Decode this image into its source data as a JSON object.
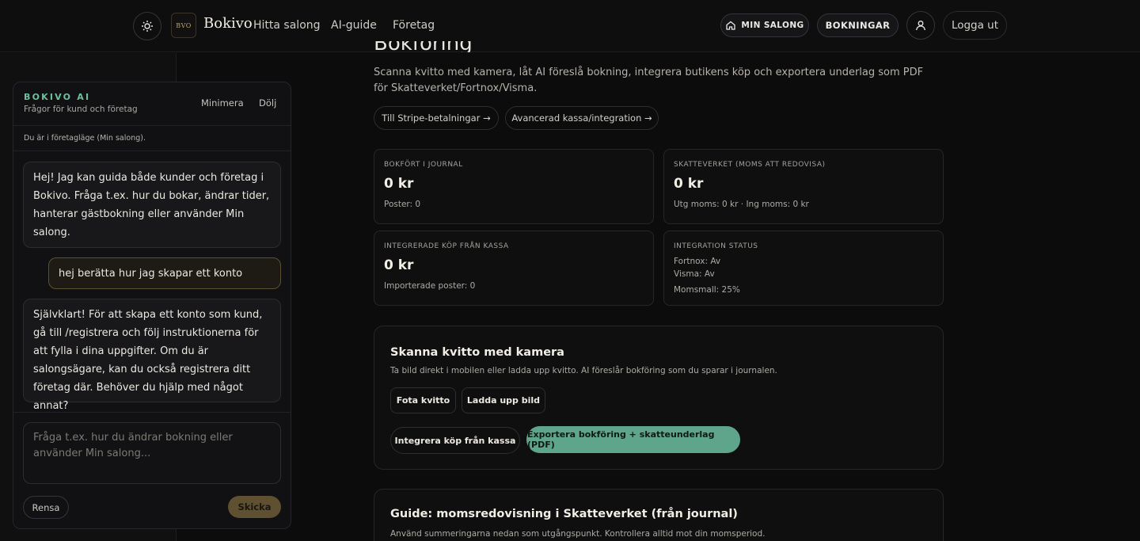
{
  "header": {
    "logo_text": "BVO",
    "brand": "Bokivo",
    "nav": [
      "Hitta salong",
      "AI-guide",
      "Företag"
    ],
    "my_salon": "MIN SALONG",
    "bookings": "BOKNINGAR",
    "logout": "Logga ut",
    "icons": [
      "sun-icon",
      "home-icon",
      "user-icon"
    ]
  },
  "chat": {
    "title": "BOKIVO AI",
    "subtitle": "Frågor för kund och företag",
    "minimize": "Minimera",
    "hide": "Dölj",
    "mode_notice": "Du är i företagläge (Min salong).",
    "messages": [
      {
        "role": "bot",
        "text": "Hej! Jag kan guida både kunder och företag i Bokivo. Fråga t.ex. hur du bokar, ändrar tider, hanterar gästbokning eller använder Min salong."
      },
      {
        "role": "user",
        "text": "hej berätta hur jag skapar ett konto"
      },
      {
        "role": "bot",
        "text": "Självklart! För att skapa ett konto som kund, gå till /registrera och följ instruktionerna för att fylla i dina uppgifter. Om du är salongsägare, kan du också registrera ditt företag där. Behöver du hjälp med något annat?"
      }
    ],
    "input_placeholder": "Fråga t.ex. hur du ändrar bokning eller använder Min salong...",
    "clear": "Rensa",
    "send": "Skicka"
  },
  "main": {
    "title_fragment": "Bokföring",
    "intro": "Scanna kvitto med kamera, låt AI föreslå bokning, integrera butikens köp och exportera underlag som PDF för Skatteverket/Fortnox/Visma.",
    "links": [
      "Till Stripe-betalningar →",
      "Avancerad kassa/integration →"
    ],
    "stats": [
      {
        "label": "BOKFÖRT I JOURNAL",
        "value": "0 kr",
        "note": "Poster: 0"
      },
      {
        "label": "SKATTEVERKET (MOMS ATT REDOVISA)",
        "value": "0 kr",
        "note": "Utg moms: 0 kr · Ing moms: 0 kr"
      },
      {
        "label": "INTEGRERADE KÖP FRÅN KASSA",
        "value": "0 kr",
        "note": "Importerade poster: 0"
      }
    ],
    "integration": {
      "label": "INTEGRATION STATUS",
      "lines": [
        "Fortnox: Av",
        "Visma: Av",
        "Momsmall: 25%"
      ]
    },
    "scan_panel": {
      "title": "Skanna kvitto med kamera",
      "desc": "Ta bild direkt i mobilen eller ladda upp kvitto. AI föreslår bokföring som du sparar i journalen.",
      "photo": "Fota kvitto",
      "upload": "Ladda upp bild",
      "integrate": "Integrera köp från kassa",
      "export": "Exportera bokföring + skatteunderlag (PDF)"
    },
    "guide_panel": {
      "title": "Guide: momsredovisning i Skatteverket (från journal)",
      "desc": "Använd summeringarna nedan som utgångspunkt. Kontrollera alltid mot din momsperiod."
    }
  },
  "colors": {
    "accent": "#5fa58c",
    "gold": "#bfa56a",
    "background": "#0c0c0d"
  }
}
